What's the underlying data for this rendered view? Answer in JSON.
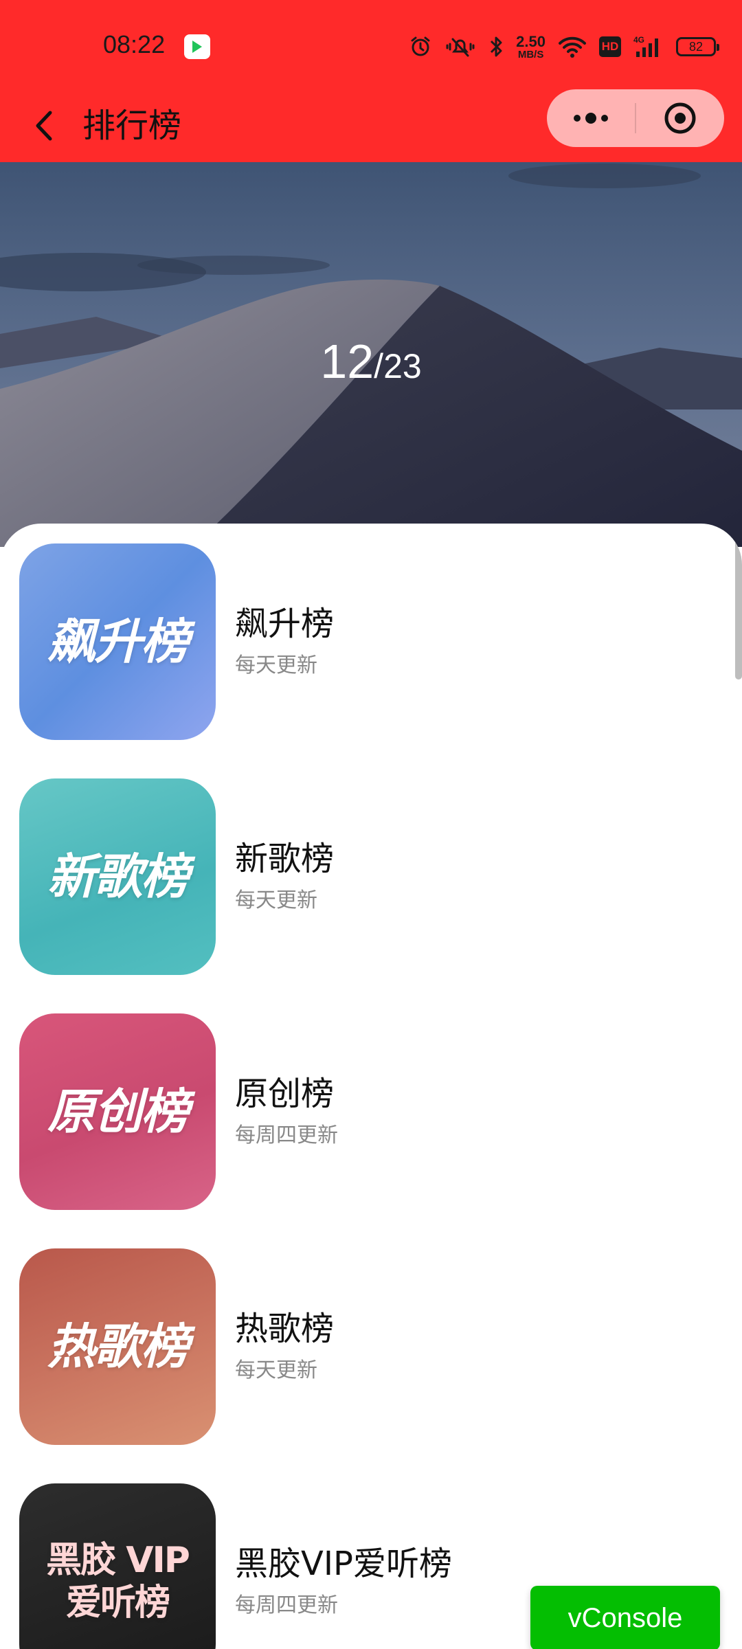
{
  "status_bar": {
    "time": "08:22",
    "net_speed_value": "2.50",
    "net_speed_unit": "MB/S",
    "hd_label": "HD",
    "network_type": "4G",
    "battery": "82",
    "icons": [
      "alarm-icon",
      "mute-icon",
      "bluetooth-icon",
      "wifi-icon",
      "signal-icon"
    ]
  },
  "nav": {
    "title": "排行榜",
    "back_icon": "chevron-left-icon",
    "more_icon": "more-dots-icon",
    "close_icon": "target-icon"
  },
  "banner": {
    "current": "12",
    "separator": "/",
    "total": "23"
  },
  "rankings": [
    {
      "title": "飙升榜",
      "subtitle": "每天更新",
      "cover_text": "飙升榜",
      "colors": [
        "#7ea3e6",
        "#8fa5ef"
      ]
    },
    {
      "title": "新歌榜",
      "subtitle": "每天更新",
      "cover_text": "新歌榜",
      "colors": [
        "#66c7c6",
        "#45b4b8"
      ]
    },
    {
      "title": "原创榜",
      "subtitle": "每周四更新",
      "cover_text": "原创榜",
      "colors": [
        "#d8567a",
        "#c94a70"
      ]
    },
    {
      "title": "热歌榜",
      "subtitle": "每天更新",
      "cover_text": "热歌榜",
      "colors": [
        "#b9584b",
        "#d99172"
      ]
    },
    {
      "title": "黑胶VIP爱听榜",
      "subtitle": "每周四更新",
      "cover_text_line1": "黑胶 VIP",
      "cover_text_line2": "爱听榜",
      "colors": [
        "#2d2d2d",
        "#1a1a1a"
      ]
    }
  ],
  "vconsole": {
    "label": "vConsole"
  },
  "colors": {
    "header_red": "#ff2a2a",
    "capsule": "#ffb3b3",
    "vconsole_green": "#04be02"
  }
}
